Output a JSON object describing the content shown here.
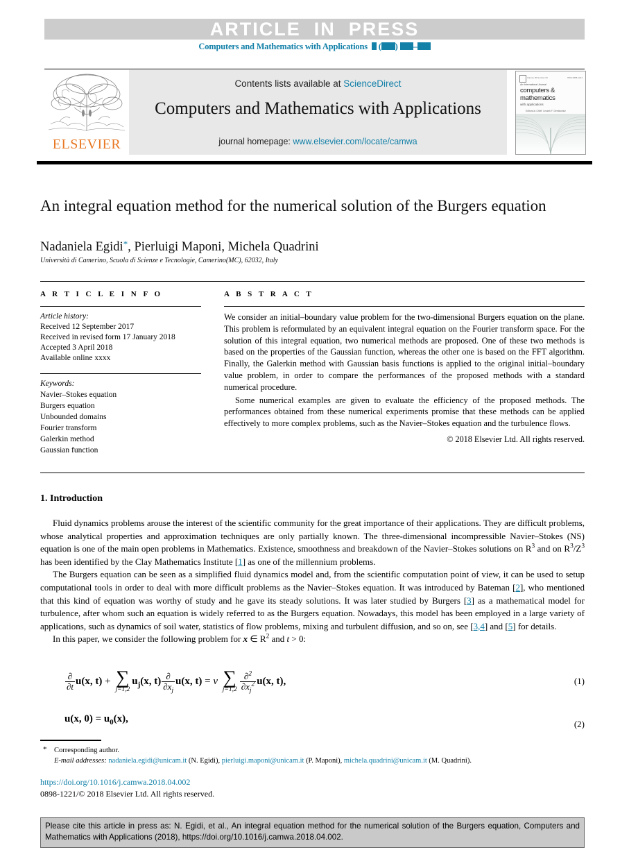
{
  "banner": {
    "article_in_press": "ARTICLE  IN  PRESS",
    "running_head_journal": "Computers and Mathematics with Applications"
  },
  "masthead": {
    "contents_prefix": "Contents lists available at ",
    "contents_link": "ScienceDirect",
    "journal_title": "Computers and Mathematics with Applications",
    "homepage_prefix": "journal homepage: ",
    "homepage_link": "www.elsevier.com/locate/camwa",
    "publisher": "ELSEVIER",
    "cover": {
      "subtitle": "An International Journal",
      "line1": "computers &",
      "line2": "mathematics",
      "line3": "with applications",
      "editors": "Editors-in-Chief:  Leszek F. Demkowicz"
    }
  },
  "article": {
    "title": "An integral equation method for the numerical solution of the Burgers equation",
    "authors": "Nadaniela Egidi",
    "authors_rest": ", Pierluigi Maponi, Michela Quadrini",
    "affiliation": "Università di Camerino, Scuola di Scienze e Tecnologie, Camerino(MC), 62032, Italy"
  },
  "info": {
    "heading": "A R T I C L E   I N F O",
    "history_label": "Article history:",
    "history": [
      "Received 12 September 2017",
      "Received in revised form 17 January 2018",
      "Accepted 3 April 2018",
      "Available online xxxx"
    ],
    "keywords_label": "Keywords:",
    "keywords": [
      "Navier–Stokes equation",
      "Burgers equation",
      "Unbounded domains",
      "Fourier transform",
      "Galerkin method",
      "Gaussian function"
    ]
  },
  "abstract": {
    "heading": "A B S T R A C T",
    "paragraph1": "We consider an initial–boundary value problem for the two-dimensional Burgers equation on the plane. This problem is reformulated by an equivalent integral equation on the Fourier transform space. For the solution of this integral equation, two numerical methods are proposed. One of these two methods is based on the properties of the Gaussian function, whereas the other one is based on the FFT algorithm. Finally, the Galerkin method with Gaussian basis functions is applied to the original initial–boundary value problem, in order to compare the performances of the proposed methods with a standard numerical procedure.",
    "paragraph2": "Some numerical examples are given to evaluate the efficiency of the proposed methods. The performances obtained from these numerical experiments promise that these methods can be applied effectively to more complex problems, such as the Navier–Stokes equation and the turbulence flows.",
    "copyright": "© 2018 Elsevier Ltd. All rights reserved."
  },
  "body": {
    "section_heading": "1. Introduction",
    "para1_a": "Fluid dynamics problems arouse the interest of the scientific community for the great importance of their applications. They are difficult problems, whose analytical properties and approximation techniques are only partially known. The three-dimensional incompressible Navier–Stokes (NS) equation is one of the main open problems in Mathematics. Existence, smoothness and breakdown of the Navier–Stokes solutions on ",
    "para1_sym1": "R",
    "para1_b": " and on ",
    "para1_sym2": "R",
    "para1_sym3": "/Z",
    "para1_c": " has been identified by the Clay Mathematics Institute [",
    "para1_ref1": "1",
    "para1_d": "] as one of the millennium problems.",
    "para2_a": "The Burgers equation can be seen as a simplified fluid dynamics model and, from the scientific computation point of view, it can be used to setup computational tools in order to deal with more difficult problems as the Navier–Stokes equation. It was introduced by Bateman [",
    "para2_ref2": "2",
    "para2_b": "], who mentioned that this kind of equation was worthy of study and he gave its steady solutions. It was later studied by Burgers [",
    "para2_ref3": "3",
    "para2_c": "] as a mathematical model for turbulence, after whom such an equation is widely referred to as the Burgers equation. Nowadays, this model has been employed in a large variety of applications, such as dynamics of soil water, statistics of flow problems, mixing and turbulent diffusion, and so on, see [",
    "para2_ref34": "3,4",
    "para2_d": "] and [",
    "para2_ref5": "5",
    "para2_e": "] for details.",
    "para3_a": "In this paper, we consider the following problem for ",
    "para3_x": "x",
    "para3_in": " ∈ ",
    "para3_sym": "R",
    "para3_b": " and ",
    "para3_t": "t",
    "para3_c": " > 0:"
  },
  "equations": {
    "eq1_number": "(1)",
    "eq2_number": "(2)",
    "eq1": {
      "d1_num": "∂",
      "d1_den": "∂t",
      "u1": "u(x, t)",
      "plus": "+",
      "sum1_sigma": "∑",
      "sum1_lim": "j=1,2",
      "uj": "u",
      "uj_sub": "j",
      "uj_args": "(x, t)",
      "d2_num": "∂",
      "d2_den": "∂x",
      "d2_den_sub": "j",
      "u2": "u(x, t)",
      "equals": "=",
      "nu": "ν",
      "sum2_sigma": "∑",
      "sum2_lim": "j=1,2",
      "d3_num": "∂",
      "d3_num_sup": "2",
      "d3_den": "∂x",
      "d3_den_sub": "j",
      "d3_den_sup": "2",
      "u3": "u(x, t),"
    },
    "eq2": {
      "lhs": "u(x, 0) = u",
      "sub": "0",
      "rhs": "(x),"
    }
  },
  "footnote": {
    "star": "*",
    "corresponding": "Corresponding author.",
    "email_label": "E-mail addresses:",
    "emails": [
      {
        "address": "nadaniela.egidi@unicam.it",
        "person": "(N. Egidi)"
      },
      {
        "address": "pierluigi.maponi@unicam.it",
        "person": "(P. Maponi)"
      },
      {
        "address": "michela.quadrini@unicam.it",
        "person": "(M. Quadrini)"
      }
    ],
    "doi": "https://doi.org/10.1016/j.camwa.2018.04.002",
    "issn_copyright": "0898-1221/© 2018 Elsevier Ltd. All rights reserved."
  },
  "cite_box": {
    "text": "Please cite this article in press as: N. Egidi, et al., An integral equation method for the numerical solution of the Burgers equation, Computers and Mathematics with Applications (2018), https://doi.org/10.1016/j.camwa.2018.04.002."
  },
  "colors": {
    "link": "#1380a8",
    "elsevier_orange": "#e87722",
    "banner_gray": "#cccccc",
    "masthead_gray": "#e8e8e8",
    "cite_gray": "#c9c9c9"
  }
}
